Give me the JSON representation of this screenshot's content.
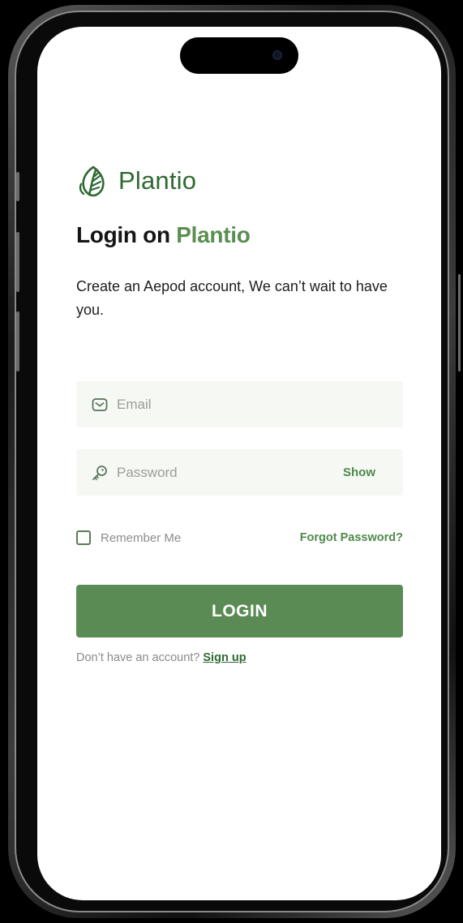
{
  "brand": {
    "name": "Plantio",
    "accent_color": "#5b8f52",
    "dark_green": "#2f6a32",
    "logo_icon": "leaf-icon"
  },
  "heading": {
    "prefix": "Login on",
    "accent": "Plantio"
  },
  "subtitle": "Create an Aepod account, We can’t wait to have you.",
  "form": {
    "email": {
      "placeholder": "Email",
      "icon": "mail-icon",
      "value": ""
    },
    "password": {
      "placeholder": "Password",
      "icon": "key-icon",
      "value": "",
      "show_label": "Show"
    },
    "remember_label": "Remember Me",
    "remember_checked": false,
    "forgot_label": "Forgot Password?",
    "login_label": "LOGIN"
  },
  "signup": {
    "prompt": "Don’t have an account?",
    "link_label": "Sign up"
  }
}
